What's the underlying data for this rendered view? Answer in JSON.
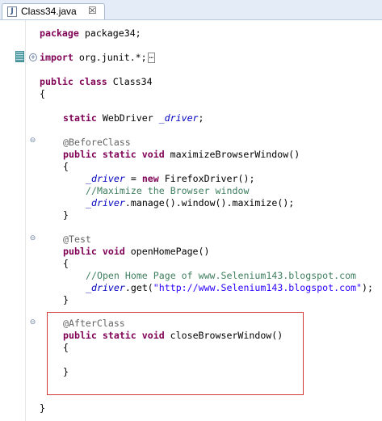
{
  "tab": {
    "title": "Class34.java",
    "close_glyph": "☒",
    "file_glyph": "J"
  },
  "code": {
    "l1_kw": "package",
    "l1_rest": " package34;",
    "l2_kw": "import",
    "l2_rest": " org.junit.*;",
    "l2_ellipsis": "…",
    "l3_kw1": "public",
    "l3_kw2": "class",
    "l3_rest": " Class34",
    "l4": "{",
    "l5_kw": "static",
    "l5_type": " WebDriver ",
    "l5_field": "_driver",
    "l5_end": ";",
    "l6_ann": "@BeforeClass",
    "l7_kw1": "public",
    "l7_kw2": "static",
    "l7_kw3": "void",
    "l7_rest": " maximizeBrowserWindow()",
    "l8": "{",
    "l9_field": "_driver",
    "l9_mid": " = ",
    "l9_kw": "new",
    "l9_rest": " FirefoxDriver();",
    "l10_cmt": "//Maximize the Browser window",
    "l11_field": "_driver",
    "l11_rest": ".manage().window().maximize();",
    "l12": "}",
    "l13_ann": "@Test",
    "l14_kw1": "public",
    "l14_kw2": "void",
    "l14_rest": " openHomePage()",
    "l15": "{",
    "l16_cmt": "//Open Home Page of www.Selenium143.blogspot.com",
    "l17_field": "_driver",
    "l17_mid": ".get(",
    "l17_str": "\"http://www.Selenium143.blogspot.com\"",
    "l17_end": ");",
    "l18": "}",
    "l19_ann": "@AfterClass",
    "l20_kw1": "public",
    "l20_kw2": "static",
    "l20_kw3": "void",
    "l20_rest": " closeBrowserWindow()",
    "l21": "{",
    "l22": "}",
    "l23": "}"
  },
  "fold": {
    "collapsed": "+",
    "expanded": "⊖"
  },
  "colors": {
    "keyword": "#7f0055",
    "field": "#0000c0",
    "annotation": "#646464",
    "comment": "#3f7f5f",
    "string": "#2a00ff",
    "highlight": "#d23a3a"
  }
}
